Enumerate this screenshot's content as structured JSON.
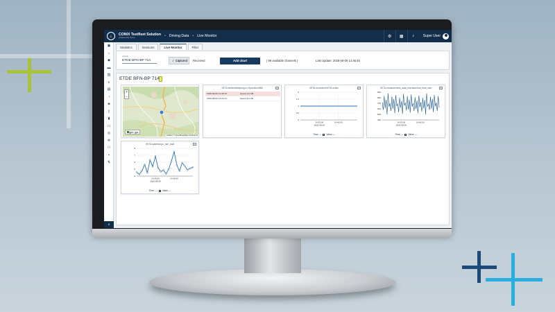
{
  "app": {
    "brand": "CONIX Testfleet Solution",
    "brand_sub": "powered by bytes",
    "breadcrumb": [
      "Driving Data",
      "Live Monitor"
    ],
    "user": "Super User"
  },
  "sidebar_icons": [
    "dashboard-icon",
    "home-icon",
    "car-icon",
    "truck-icon",
    "chart-icon",
    "list-icon",
    "document-icon",
    "gauge-icon",
    "map-icon",
    "phone-icon",
    "battery-icon",
    "device-icon",
    "database-icon",
    "settings-icon",
    "group-icon",
    "lock-icon",
    "transfer-icon"
  ],
  "tabs": [
    {
      "label": "Statistics",
      "active": false
    },
    {
      "label": "Sessions",
      "active": false
    },
    {
      "label": "Live Monitor",
      "active": true
    },
    {
      "label": "Filter",
      "active": false
    }
  ],
  "controls": {
    "vehicle_label": "Vehicle",
    "vehicle_value": "ETDE BFN-BP 714",
    "toggle_captured": "Captured",
    "toggle_received": "Received",
    "add_chart": "Add chart",
    "channels_info": "( 99 available channels )",
    "last_update": "Last Update: 2026-08-09 14:46:45"
  },
  "dashboard": {
    "title": "ETDE BFN-BP 714"
  },
  "map_card": {
    "legend": "gps / gps",
    "attribution": "Leaflet | © OpenStreetMap contributors",
    "zoom_in": "+",
    "zoom_out": "−"
  },
  "table_card": {
    "title": "XETA.blebereitstellung.nr./SpeedLimitB8",
    "rows": [
      {
        "time": "2026-08-09 14:46:19",
        "value": "Speed Lmt 80"
      },
      {
        "time": "2026-08-09 14:23:44",
        "value": "Speed Lmt 80"
      }
    ]
  },
  "chart1": {
    "title": "XETA.recorders/XETA.online",
    "legend_time": "Time:",
    "legend_value": "Value"
  },
  "chart2": {
    "title": "XETA.measurement_data_interface/real_time_rate",
    "legend_time": "Time:",
    "legend_value": "Value"
  },
  "chart3": {
    "title": "XETA.system/cpu_use_total",
    "legend_time": "Time:",
    "legend_value": "Value"
  },
  "chart_data": [
    {
      "type": "line",
      "title": "XETA.recorders/XETA.online",
      "x": [
        "14:30",
        "14:35",
        "14:40",
        "14:45"
      ],
      "xtick_labels": [
        "14:35:00",
        "14:40:00"
      ],
      "xtick_sub": "2026-08-09",
      "y": [
        1,
        1,
        1,
        1
      ],
      "ylim": [
        0,
        2
      ],
      "yticks": [
        "2",
        "1.5",
        "1",
        "0.5",
        "0"
      ],
      "grid": true
    },
    {
      "type": "line",
      "title": "XETA.measurement_data_interface/real_time_rate",
      "xtick_labels": [
        "14:35:00",
        "14:40:00"
      ],
      "xtick_sub": "2026-08-09",
      "y": [
        720,
        580,
        830,
        610,
        760,
        500,
        880,
        640,
        700,
        560,
        820,
        600,
        780,
        520,
        850,
        650,
        690,
        540,
        800,
        620,
        740,
        510,
        870,
        660,
        710,
        570,
        830,
        590,
        770,
        530,
        860,
        640,
        700,
        560,
        810,
        600,
        750,
        520,
        840,
        630,
        720,
        550,
        800,
        610,
        760,
        500,
        880,
        640,
        690,
        580,
        820,
        600,
        780,
        540,
        850,
        650,
        710,
        560,
        830,
        620
      ],
      "ylim": [
        400,
        900
      ],
      "yticks": [
        "900",
        "800",
        "700",
        "600",
        "500",
        "400"
      ],
      "grid": true
    },
    {
      "type": "line",
      "title": "XETA.system/cpu_use_total",
      "xtick_labels": [
        "14:35:00",
        "14:40:00"
      ],
      "xtick_sub": "2026-08-09",
      "y": [
        4.2,
        3.8,
        4.5,
        5.6,
        4.1,
        6.4,
        5.2,
        7.1,
        5.0,
        4.3,
        4.6,
        3.9,
        4.8,
        6.2,
        7.9,
        5.5,
        4.4,
        5.9,
        5.3,
        4.6,
        4.9,
        5.1
      ],
      "ylim": [
        3.5,
        8.5
      ],
      "yticks": [
        "8",
        "7",
        "6",
        "5",
        "4"
      ],
      "grid": true
    }
  ]
}
